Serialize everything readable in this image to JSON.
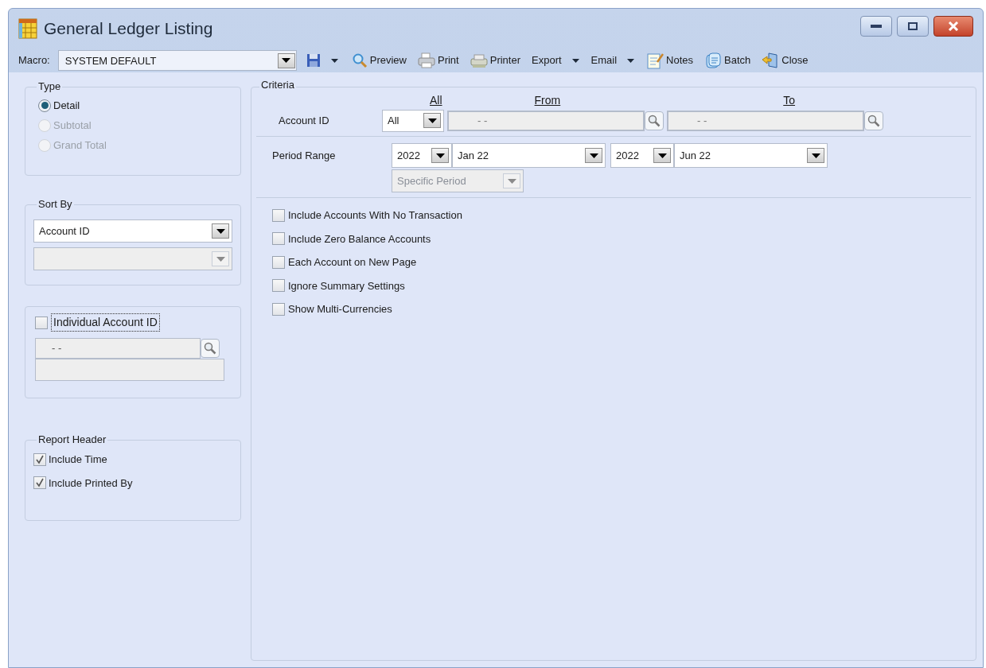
{
  "window": {
    "title": "General Ledger Listing"
  },
  "toolbar": {
    "macro_label": "Macro:",
    "macro_value": "SYSTEM DEFAULT",
    "buttons": [
      {
        "dropdown": true
      },
      {
        "label": "Preview",
        "dropdown": false
      },
      {
        "label": "Print",
        "dropdown": false
      },
      {
        "label": "Printer",
        "dropdown": false
      },
      {
        "label": "Export",
        "dropdown": true
      },
      {
        "label": "Email",
        "dropdown": true
      },
      {
        "label": "Notes",
        "dropdown": false
      },
      {
        "label": "Batch",
        "dropdown": false
      },
      {
        "label": "Close",
        "dropdown": false
      }
    ]
  },
  "type_group": {
    "title": "Type",
    "options": [
      {
        "label": "Detail",
        "selected": true,
        "disabled": false
      },
      {
        "label": "Subtotal",
        "selected": false,
        "disabled": true
      },
      {
        "label": "Grand Total",
        "selected": false,
        "disabled": true
      }
    ]
  },
  "sort_by": {
    "title": "Sort By",
    "fields": [
      {
        "value": "Account ID",
        "disabled": false
      },
      {
        "disabled": true
      }
    ]
  },
  "individual_account": {
    "label": "Individual Account ID",
    "checked": false,
    "id_value": "-  -"
  },
  "report_header": {
    "title": "Report Header",
    "items": [
      {
        "label": "Include Time",
        "checked": true
      },
      {
        "label": "Include Printed By",
        "checked": true
      }
    ]
  },
  "criteria": {
    "title": "Criteria",
    "headers": [
      "All",
      "From",
      "To"
    ],
    "account": {
      "label": "Account ID",
      "all_value": "All",
      "from_value": "-  -",
      "to_value": "-  -"
    },
    "period": {
      "label": "Period Range",
      "from_year": "2022",
      "from_period": "Jan 22",
      "to_year": "2022",
      "to_period": "Jun 22",
      "mode": "Specific Period",
      "mode_disabled": true
    },
    "options": [
      {
        "label": "Include Accounts With No Transaction",
        "checked": false
      },
      {
        "label": "Include Zero Balance Accounts",
        "checked": false
      },
      {
        "label": "Each Account on New Page",
        "checked": false
      },
      {
        "label": "Ignore Summary Settings",
        "checked": false
      },
      {
        "label": "Show Multi-Currencies",
        "checked": false
      }
    ]
  }
}
